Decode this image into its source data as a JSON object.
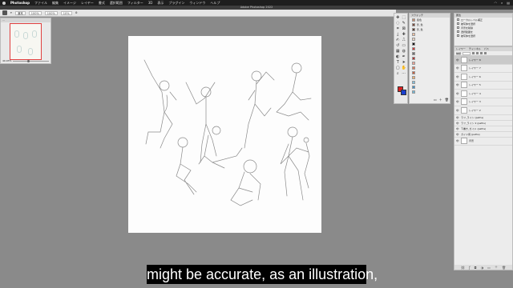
{
  "menubar": {
    "app": "Photoshop",
    "items": [
      "ファイル",
      "編集",
      "イメージ",
      "レイヤー",
      "書式",
      "選択範囲",
      "フィルター",
      "3D",
      "表示",
      "プラグイン",
      "ウィンドウ",
      "ヘルプ"
    ]
  },
  "window": {
    "title": "Adobe Photoshop 2022"
  },
  "options": {
    "mode": "通常",
    "opacity": "100%",
    "flow": "100%",
    "smoothing": "10%"
  },
  "navigator": {
    "zoom": "40.93%"
  },
  "swatches": {
    "title": "スウォッチ",
    "rows": [
      {
        "label": "肌色",
        "color": "#c88a6a"
      },
      {
        "label": "影_色",
        "color": "#7a4a3a"
      },
      {
        "label": "影_色",
        "color": "#5a3a30"
      },
      {
        "label": "",
        "color": "#f2c0a0"
      },
      {
        "label": "",
        "color": "#e8d2c0"
      },
      {
        "label": "",
        "color": "#101010"
      },
      {
        "label": "",
        "color": "#d03838"
      },
      {
        "label": "",
        "color": "#707070"
      },
      {
        "label": "",
        "color": "#b03030"
      },
      {
        "label": "",
        "color": "#f0a090"
      },
      {
        "label": "",
        "color": "#e07858"
      },
      {
        "label": "",
        "color": "#c86040"
      },
      {
        "label": "",
        "color": "#f4b070"
      },
      {
        "label": "",
        "color": "#80c0e0"
      },
      {
        "label": "",
        "color": "#4090c8"
      },
      {
        "label": "",
        "color": "#70b8d8"
      }
    ]
  },
  "properties": {
    "title": "属性",
    "rows": [
      "ローカルレベル補正",
      "被写体を選択",
      "背景を削除",
      "選択範囲を",
      "被写体を選択"
    ]
  },
  "layers": {
    "tabs": [
      "レイヤー",
      "チャンネル",
      "パス"
    ],
    "kind": "種類",
    "rows": [
      {
        "name": "レイヤー 8",
        "selected": true,
        "small": false
      },
      {
        "name": "レイヤー 7",
        "selected": false,
        "small": false
      },
      {
        "name": "レイヤー 6",
        "selected": false,
        "small": false
      },
      {
        "name": "レイヤー 5",
        "selected": false,
        "small": false
      },
      {
        "name": "レイヤー 4",
        "selected": false,
        "small": false
      },
      {
        "name": "レイヤー 3",
        "selected": false,
        "small": false
      },
      {
        "name": "レイヤー 2",
        "selected": false,
        "small": false
      },
      {
        "name": "ラフ_ライン (paths)",
        "selected": false,
        "small": true
      },
      {
        "name": "ラフ_ライン 2 (paths)",
        "selected": false,
        "small": true
      },
      {
        "name": "下書き_ガイド (paths)",
        "selected": false,
        "small": true
      },
      {
        "name": "ガイド用 (paths)",
        "selected": false,
        "small": true
      },
      {
        "name": "背景",
        "selected": false,
        "small": false
      }
    ]
  },
  "subtitle": "might be accurate, as an illustration,"
}
